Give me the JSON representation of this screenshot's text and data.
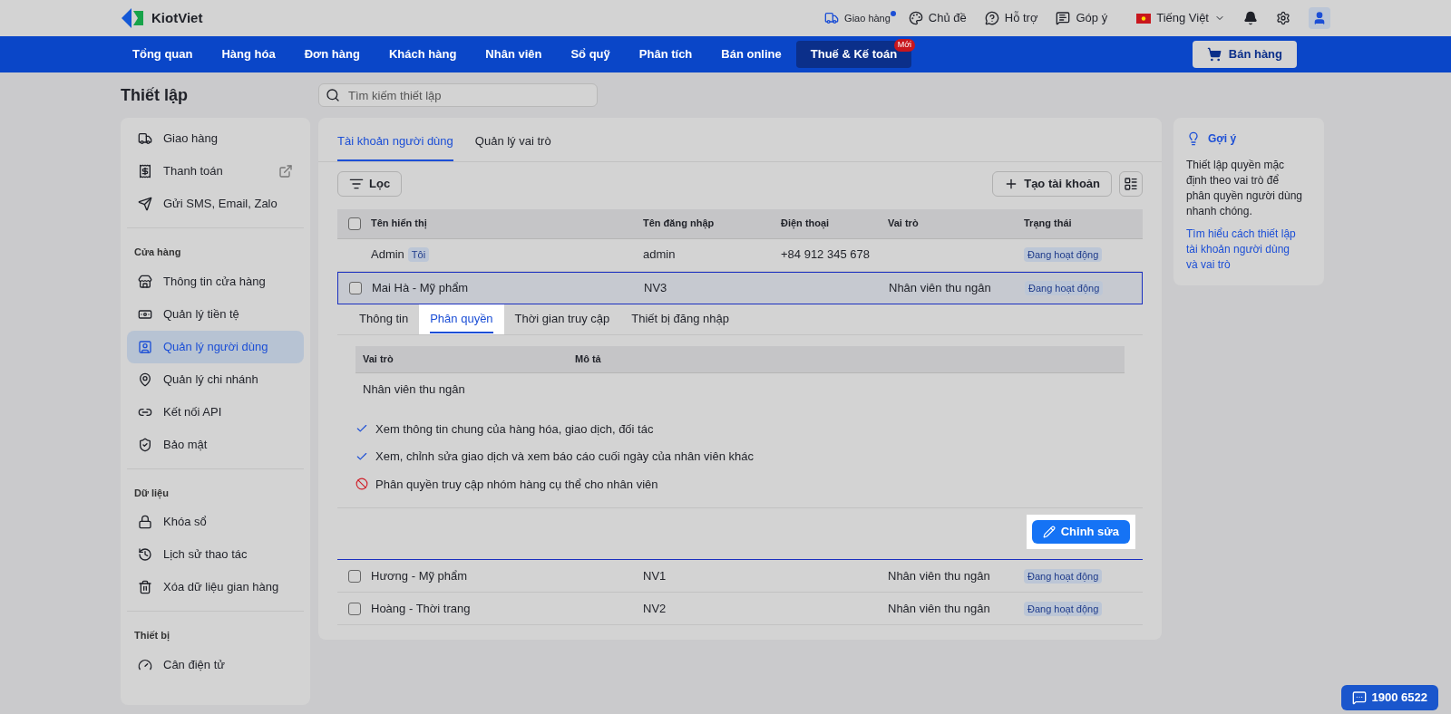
{
  "top_bar": {
    "logo": "KiotViet",
    "links": [
      {
        "label": "Giao hàng",
        "kind": "delivery",
        "dot": true
      },
      {
        "label": "Chủ đề",
        "kind": "theme",
        "dot": false
      },
      {
        "label": "Hỗ trợ",
        "kind": "help",
        "dot": false
      },
      {
        "label": "Góp ý",
        "kind": "feedback",
        "dot": false
      }
    ],
    "language": "Tiếng Việt"
  },
  "nav": {
    "items": [
      {
        "label": "Tổng quan",
        "selected": false
      },
      {
        "label": "Hàng hóa",
        "selected": false
      },
      {
        "label": "Đơn hàng",
        "selected": false
      },
      {
        "label": "Khách hàng",
        "selected": false
      },
      {
        "label": "Nhân viên",
        "selected": false
      },
      {
        "label": "Sổ quỹ",
        "selected": false
      },
      {
        "label": "Phân tích",
        "selected": false
      },
      {
        "label": "Bán online",
        "selected": false
      },
      {
        "label": "Thuế & Kế toán",
        "selected": true,
        "badge": "Mới"
      }
    ],
    "sell_button": "Bán hàng"
  },
  "page": {
    "title": "Thiết lập",
    "search": {
      "placeholder": "Tìm kiếm thiết lập"
    }
  },
  "sidebar": {
    "sections": [
      {
        "items": [
          {
            "label": "Giao hàng",
            "kind": "truck",
            "selected": false,
            "external": false
          },
          {
            "label": "Thanh toán",
            "kind": "payment",
            "selected": false,
            "external": true
          },
          {
            "label": "Gửi SMS, Email, Zalo",
            "kind": "send",
            "selected": false,
            "external": false
          }
        ]
      },
      {
        "heading": "Cửa hàng",
        "items": [
          {
            "label": "Thông tin cửa hàng",
            "kind": "store",
            "selected": false,
            "external": false
          },
          {
            "label": "Quản lý tiền tệ",
            "kind": "money",
            "selected": false,
            "external": false
          },
          {
            "label": "Quản lý người dùng",
            "kind": "user",
            "selected": true,
            "external": false
          },
          {
            "label": "Quản lý chi nhánh",
            "kind": "pin",
            "selected": false,
            "external": false
          },
          {
            "label": "Kết nối API",
            "kind": "link",
            "selected": false,
            "external": false
          },
          {
            "label": "Bảo mật",
            "kind": "shield",
            "selected": false,
            "external": false
          }
        ]
      },
      {
        "heading": "Dữ liệu",
        "items": [
          {
            "label": "Khóa sổ",
            "kind": "lock",
            "selected": false,
            "external": false
          },
          {
            "label": "Lịch sử thao tác",
            "kind": "history",
            "selected": false,
            "external": false
          },
          {
            "label": "Xóa dữ liệu gian hàng",
            "kind": "trash",
            "selected": false,
            "external": false
          }
        ]
      },
      {
        "heading": "Thiết bị",
        "items": [
          {
            "label": "Cân điện tử",
            "kind": "gauge",
            "selected": false,
            "external": false
          }
        ]
      }
    ]
  },
  "main": {
    "tabs": [
      {
        "label": "Tài khoản người dùng",
        "selected": true
      },
      {
        "label": "Quản lý vai trò",
        "selected": false
      }
    ],
    "filter_button": "Lọc",
    "create_button": "Tạo tài khoản",
    "table": {
      "all_checked": false,
      "columns": [
        "Tên hiển thị",
        "Tên đăng nhập",
        "Điện thoại",
        "Vai trò",
        "Trạng thái"
      ],
      "rows": [
        {
          "name": "Admin",
          "tag": "Tôi",
          "login": "admin",
          "phone": "+84 912 345 678",
          "status": "Đang hoạt động",
          "expanded": false
        },
        {
          "name": "Mai Hà - Mỹ phẩm",
          "login": "NV3",
          "role": "Nhân viên thu ngân",
          "status": "Đang hoạt động",
          "checked": false,
          "expanded": true
        },
        {
          "name": "Hương - Mỹ phẩm",
          "login": "NV1",
          "role": "Nhân viên thu ngân",
          "status": "Đang hoạt động",
          "checked": false,
          "expanded": false
        },
        {
          "name": "Hoàng - Thời trang",
          "login": "NV2",
          "role": "Nhân viên thu ngân",
          "status": "Đang hoạt động",
          "checked": false,
          "expanded": false
        }
      ]
    },
    "detail": {
      "tabs": [
        {
          "label": "Thông tin",
          "selected": false
        },
        {
          "label": "Phân quyền",
          "selected": true
        },
        {
          "label": "Thời gian truy cập",
          "selected": false
        },
        {
          "label": "Thiết bị đăng nhập",
          "selected": false
        }
      ],
      "role_columns": [
        "Vai trò",
        "Mô tả"
      ],
      "role": "Nhân viên thu ngân",
      "permissions": [
        {
          "text": "Xem thông tin chung của hàng hóa, giao dịch, đối tác",
          "allowed": true
        },
        {
          "text": "Xem, chỉnh sửa giao dịch và xem báo cáo cuối ngày của nhân viên khác",
          "allowed": true
        },
        {
          "text": "Phân quyền truy cập nhóm hàng cụ thể cho nhân viên",
          "allowed": false
        }
      ],
      "edit_button": "Chỉnh sửa"
    }
  },
  "hint": {
    "title": "Gợi ý",
    "text": "Thiết lập quyền mặc định theo vai trò để phân quyền người dùng nhanh chóng.",
    "link": "Tìm hiểu cách thiết lập tài khoản người dùng và vai trò"
  },
  "support_button": "1900 6522"
}
